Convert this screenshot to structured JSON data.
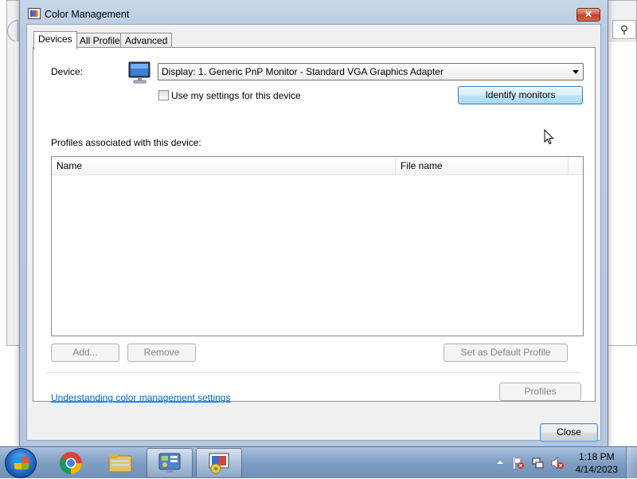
{
  "window": {
    "title": "Color Management",
    "close_label": "✕"
  },
  "tabs": [
    {
      "label": "Devices"
    },
    {
      "label": "All Profiles"
    },
    {
      "label": "Advanced"
    }
  ],
  "devices": {
    "device_label": "Device:",
    "device_value": "Display: 1. Generic PnP Monitor - Standard VGA Graphics Adapter",
    "use_settings_label": "Use my settings for this device",
    "use_settings_checked": false,
    "identify_button": "Identify monitors",
    "profiles_label": "Profiles associated with this device:",
    "columns": [
      "Name",
      "File name"
    ],
    "add_button": "Add...",
    "remove_button": "Remove",
    "set_default_button": "Set as Default Profile",
    "link": "Understanding color management settings",
    "profiles_button": "Profiles"
  },
  "footer": {
    "close_button": "Close"
  },
  "taskbar": {
    "time": "1:18 PM",
    "date": "4/14/2023",
    "pinned": [
      "chrome-icon",
      "explorer-folder-icon",
      "control-panel-icon",
      "color-management-icon"
    ]
  },
  "colors": {
    "link": "#0066cc",
    "title_bar": "#b8cbe2",
    "close_red": "#c23a21"
  }
}
